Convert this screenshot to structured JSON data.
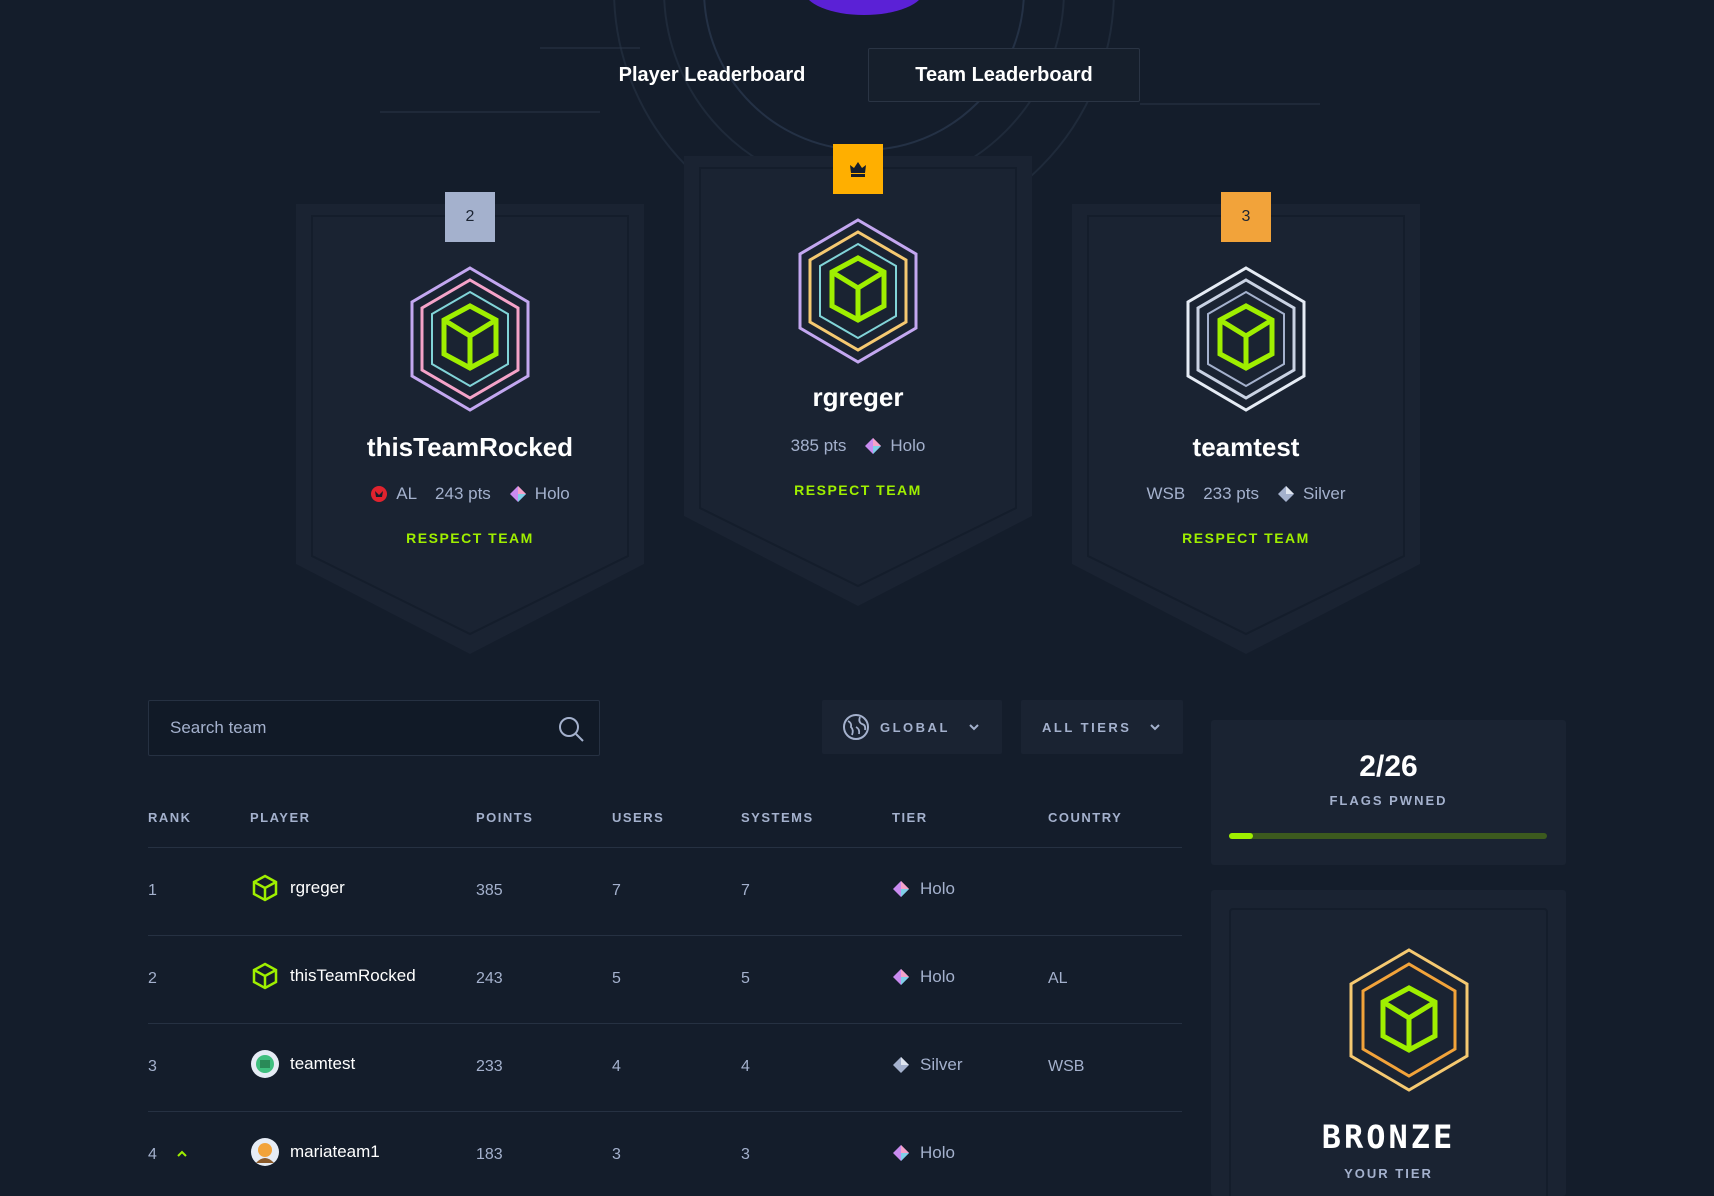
{
  "tabs": {
    "player": "Player Leaderboard",
    "team": "Team Leaderboard"
  },
  "podium": [
    {
      "rank_label": "",
      "name": "rgreger",
      "points": "385 pts",
      "tier": "Holo",
      "country": "",
      "action": "RESPECT TEAM"
    },
    {
      "rank_label": "2",
      "name": "thisTeamRocked",
      "points": "243 pts",
      "tier": "Holo",
      "country": "AL",
      "action": "RESPECT TEAM"
    },
    {
      "rank_label": "3",
      "name": "teamtest",
      "points": "233 pts",
      "tier": "Silver",
      "country": "WSB",
      "action": "RESPECT TEAM"
    }
  ],
  "search": {
    "placeholder": "Search team"
  },
  "filters": {
    "region": "GLOBAL",
    "tiers": "ALL TIERS"
  },
  "table": {
    "headers": [
      "RANK",
      "PLAYER",
      "POINTS",
      "USERS",
      "SYSTEMS",
      "TIER",
      "COUNTRY"
    ],
    "rows": [
      {
        "rank": "1",
        "player": "rgreger",
        "points": "385",
        "users": "7",
        "systems": "7",
        "tier": "Holo",
        "country": ""
      },
      {
        "rank": "2",
        "player": "thisTeamRocked",
        "points": "243",
        "users": "5",
        "systems": "5",
        "tier": "Holo",
        "country": "AL"
      },
      {
        "rank": "3",
        "player": "teamtest",
        "points": "233",
        "users": "4",
        "systems": "4",
        "tier": "Silver",
        "country": "WSB"
      },
      {
        "rank": "4",
        "player": "mariateam1",
        "points": "183",
        "users": "3",
        "systems": "3",
        "tier": "Holo",
        "country": ""
      }
    ]
  },
  "flags": {
    "count": "2/26",
    "label": "FLAGS PWNED",
    "progress": 0.077
  },
  "your_tier": {
    "name": "BRONZE",
    "label": "YOUR TIER"
  },
  "colors": {
    "accent": "#9fef00",
    "bg": "#141d2b",
    "panel": "#1a2332",
    "muted": "#a4b1cd",
    "gold": "#ffaf00",
    "bronze": "#f2a33a",
    "silver": "#a4b1cd"
  },
  "icons": {
    "search": "search-icon",
    "globe": "globe-icon",
    "chevron": "chevron-down-icon",
    "crown": "crown-icon",
    "cube": "cube-icon",
    "diamond": "diamond-icon",
    "rank_up": "arrow-up-icon",
    "flag": "flag-icon"
  }
}
